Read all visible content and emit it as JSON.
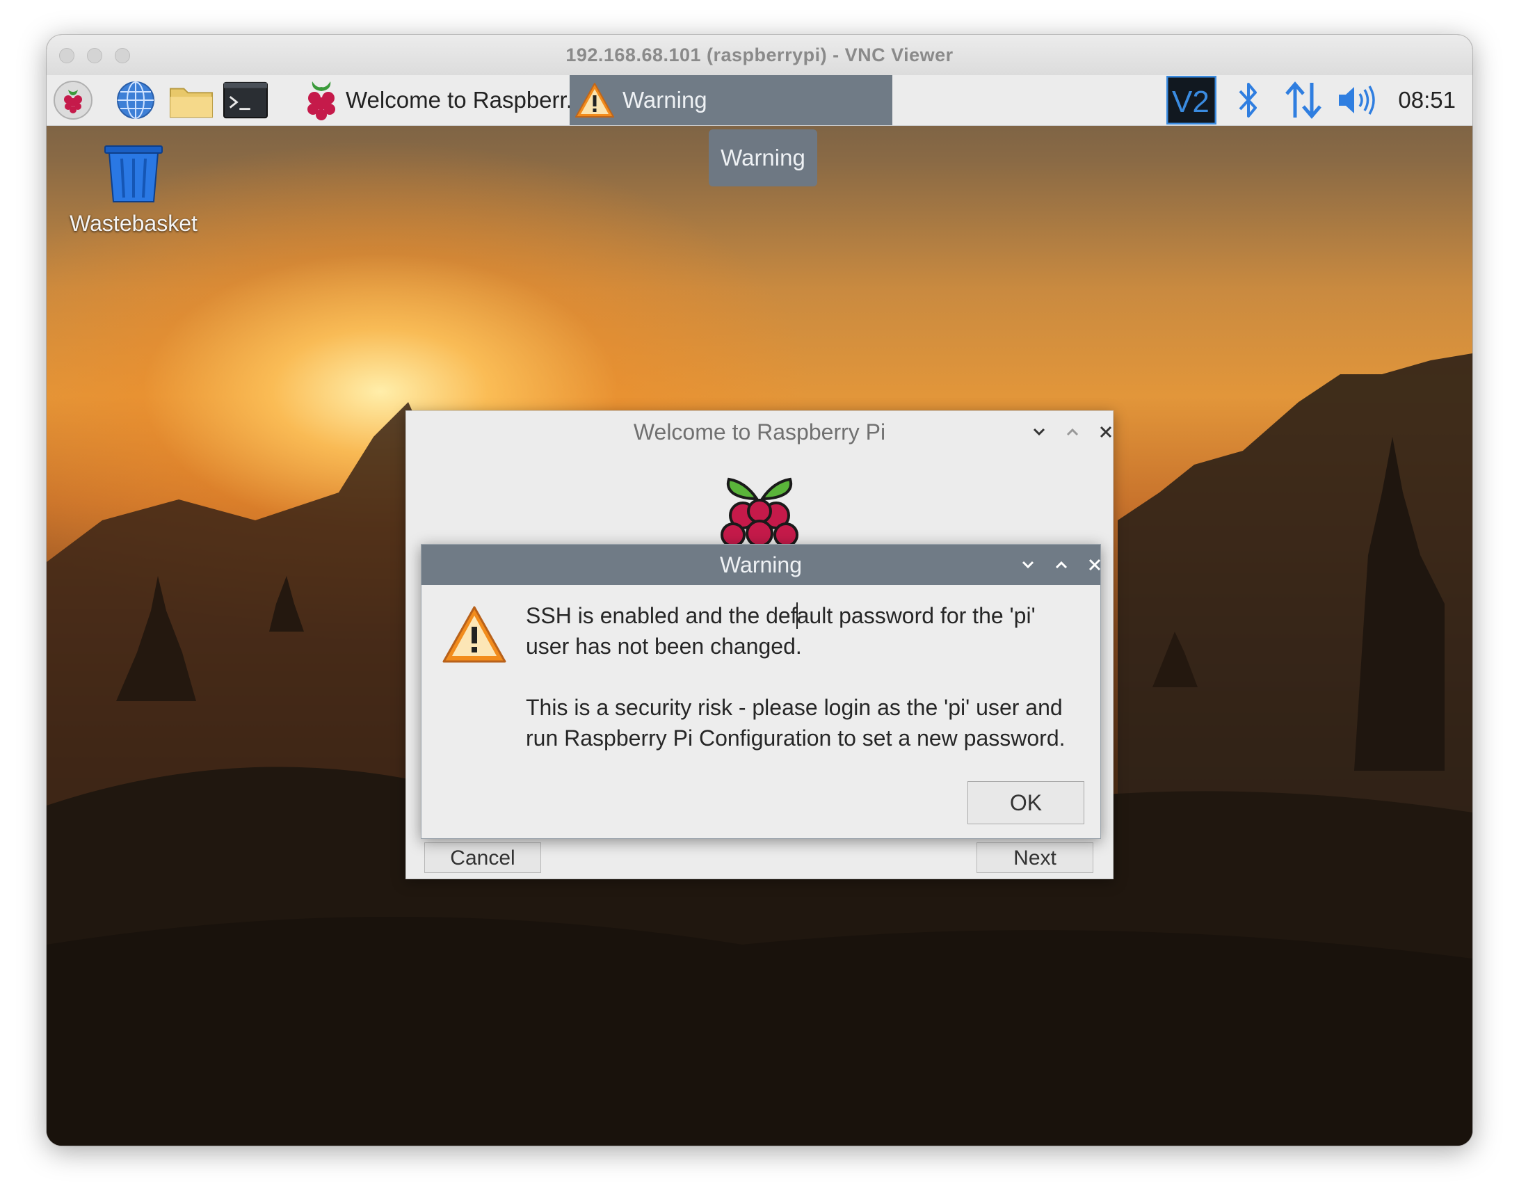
{
  "mac_window": {
    "title": "192.168.68.101 (raspberrypi) - VNC Viewer"
  },
  "taskbar": {
    "launchers": [
      {
        "name": "raspberry-menu",
        "icon": "raspberry-icon"
      },
      {
        "name": "web-browser",
        "icon": "globe-icon"
      },
      {
        "name": "file-manager",
        "icon": "folder-icon"
      },
      {
        "name": "terminal",
        "icon": "terminal-icon"
      }
    ],
    "tasks": [
      {
        "label": "Welcome to Raspberr...",
        "icon": "raspberry-icon",
        "active": false
      },
      {
        "label": "Warning",
        "icon": "warning-icon",
        "active": true
      }
    ],
    "tooltip": "Warning",
    "tray_icons": [
      "vnc-icon",
      "bluetooth-icon",
      "network-icon",
      "volume-icon"
    ],
    "clock": "08:51"
  },
  "desktop": {
    "icons": [
      {
        "label": "Wastebasket",
        "icon": "wastebasket-icon"
      }
    ]
  },
  "welcome_dialog": {
    "title": "Welcome to Raspberry Pi",
    "cancel_label": "Cancel",
    "next_label": "Next"
  },
  "warning_dialog": {
    "title": "Warning",
    "message_line1_before_caret": "SSH is enabled and the def",
    "message_line1_after_caret": "ault password for the 'pi' user has not been changed.",
    "message_line2": "This is a security risk - please login as the 'pi' user and run Raspberry Pi Configuration to set a new password.",
    "ok_label": "OK"
  },
  "colors": {
    "taskbar_bg": "#ececec",
    "active_task_bg": "#707b86",
    "dialog_bg": "#ececec",
    "warning_orange": "#f28c1c"
  }
}
